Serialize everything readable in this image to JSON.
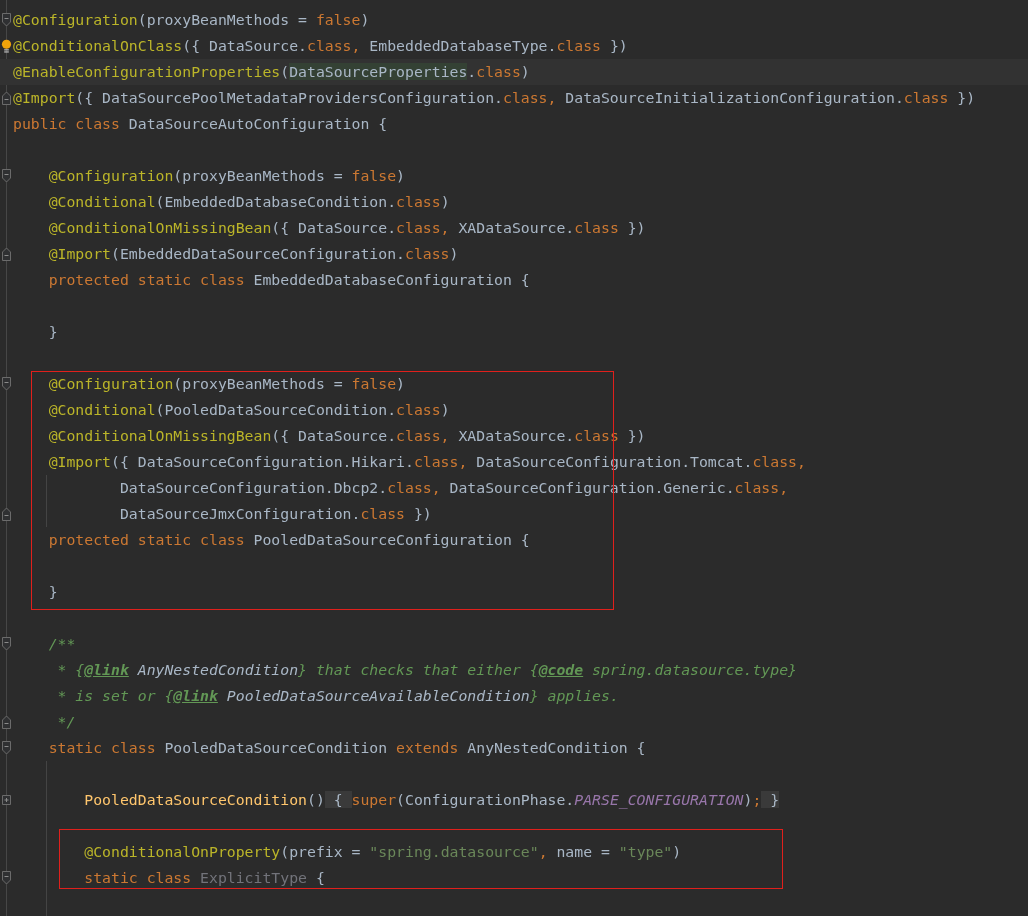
{
  "editor": {
    "sections": [
      {
        "lines": [
          {
            "fold_start": true,
            "tokens": [
              {
                "kind": "annotation",
                "text": "@Configuration"
              },
              {
                "kind": "plain",
                "text": "(proxyBeanMethods = "
              },
              {
                "kind": "keyword",
                "text": "false"
              },
              {
                "kind": "plain",
                "text": ")"
              }
            ]
          },
          {
            "bulb": true,
            "tokens": [
              {
                "kind": "annotation",
                "text": "@ConditionalOnClass"
              },
              {
                "kind": "plain",
                "text": "({ DataSource."
              },
              {
                "kind": "keyword",
                "text": "class, "
              },
              {
                "kind": "plain",
                "text": "EmbeddedDatabaseType."
              },
              {
                "kind": "keyword",
                "text": "class"
              },
              {
                "kind": "plain",
                "text": " })"
              }
            ]
          },
          {
            "current": true,
            "tokens": [
              {
                "kind": "annotation",
                "text": "@EnableConfigurationProperties"
              },
              {
                "kind": "plain",
                "text": "("
              },
              {
                "kind": "match",
                "text": "DataSourceProperties"
              },
              {
                "kind": "plain",
                "text": "."
              },
              {
                "kind": "keyword",
                "text": "class"
              },
              {
                "kind": "plain",
                "text": ")"
              }
            ]
          },
          {
            "fold_end": true,
            "tokens": [
              {
                "kind": "annotation",
                "text": "@Import"
              },
              {
                "kind": "plain",
                "text": "({ DataSourcePoolMetadataProvidersConfiguration."
              },
              {
                "kind": "keyword",
                "text": "class, "
              },
              {
                "kind": "plain",
                "text": "DataSourceInitializationConfiguration."
              },
              {
                "kind": "keyword",
                "text": "class"
              },
              {
                "kind": "plain",
                "text": " })"
              }
            ]
          },
          {
            "tokens": [
              {
                "kind": "keyword",
                "text": "public class "
              },
              {
                "kind": "plain",
                "text": "DataSourceAutoConfiguration {"
              }
            ]
          },
          {
            "kind": "blank"
          },
          {
            "fold_start": true,
            "tokens": [
              {
                "kind": "annotation",
                "text": "    @Configuration"
              },
              {
                "kind": "plain",
                "text": "(proxyBeanMethods = "
              },
              {
                "kind": "keyword",
                "text": "false"
              },
              {
                "kind": "plain",
                "text": ")"
              }
            ]
          },
          {
            "tokens": [
              {
                "kind": "annotation",
                "text": "    @Conditional"
              },
              {
                "kind": "plain",
                "text": "(EmbeddedDatabaseCondition."
              },
              {
                "kind": "keyword",
                "text": "class"
              },
              {
                "kind": "plain",
                "text": ")"
              }
            ]
          },
          {
            "tokens": [
              {
                "kind": "annotation",
                "text": "    @ConditionalOnMissingBean"
              },
              {
                "kind": "plain",
                "text": "({ DataSource."
              },
              {
                "kind": "keyword",
                "text": "class, "
              },
              {
                "kind": "plain",
                "text": "XADataSource."
              },
              {
                "kind": "keyword",
                "text": "class"
              },
              {
                "kind": "plain",
                "text": " })"
              }
            ]
          },
          {
            "fold_end": true,
            "tokens": [
              {
                "kind": "annotation",
                "text": "    @Import"
              },
              {
                "kind": "plain",
                "text": "(EmbeddedDataSourceConfiguration."
              },
              {
                "kind": "keyword",
                "text": "class"
              },
              {
                "kind": "plain",
                "text": ")"
              }
            ]
          },
          {
            "tokens": [
              {
                "kind": "keyword",
                "text": "    protected static class "
              },
              {
                "kind": "plain",
                "text": "EmbeddedDatabaseConfiguration {"
              }
            ]
          },
          {
            "kind": "blank"
          },
          {
            "tokens": [
              {
                "kind": "plain",
                "text": "    }"
              }
            ]
          },
          {
            "kind": "blank"
          }
        ]
      },
      {
        "boxed": true,
        "lines": [
          {
            "fold_start": true,
            "tokens": [
              {
                "kind": "annotation",
                "text": "    @Configuration"
              },
              {
                "kind": "plain",
                "text": "(proxyBeanMethods = "
              },
              {
                "kind": "keyword",
                "text": "false"
              },
              {
                "kind": "plain",
                "text": ")"
              }
            ]
          },
          {
            "tokens": [
              {
                "kind": "annotation",
                "text": "    @Conditional"
              },
              {
                "kind": "plain",
                "text": "(PooledDataSourceCondition."
              },
              {
                "kind": "keyword",
                "text": "class"
              },
              {
                "kind": "plain",
                "text": ")"
              }
            ]
          },
          {
            "tokens": [
              {
                "kind": "annotation",
                "text": "    @ConditionalOnMissingBean"
              },
              {
                "kind": "plain",
                "text": "({ DataSource."
              },
              {
                "kind": "keyword",
                "text": "class, "
              },
              {
                "kind": "plain",
                "text": "XADataSource."
              },
              {
                "kind": "keyword",
                "text": "class"
              },
              {
                "kind": "plain",
                "text": " })"
              }
            ]
          },
          {
            "tokens": [
              {
                "kind": "annotation",
                "text": "    @Import"
              },
              {
                "kind": "plain",
                "text": "({ DataSourceConfiguration.Hikari."
              },
              {
                "kind": "keyword",
                "text": "class, "
              },
              {
                "kind": "plain",
                "text": "DataSourceConfiguration.Tomcat."
              },
              {
                "kind": "keyword",
                "text": "class,"
              }
            ]
          },
          {
            "guide": true,
            "tokens": [
              {
                "kind": "plain",
                "text": "            DataSourceConfiguration.Dbcp2."
              },
              {
                "kind": "keyword",
                "text": "class, "
              },
              {
                "kind": "plain",
                "text": "DataSourceConfiguration.Generic."
              },
              {
                "kind": "keyword",
                "text": "class,"
              }
            ]
          },
          {
            "guide": true,
            "fold_end": true,
            "tokens": [
              {
                "kind": "plain",
                "text": "            DataSourceJmxConfiguration."
              },
              {
                "kind": "keyword",
                "text": "class"
              },
              {
                "kind": "plain",
                "text": " })"
              }
            ]
          },
          {
            "tokens": [
              {
                "kind": "keyword",
                "text": "    protected static class "
              },
              {
                "kind": "plain",
                "text": "PooledDataSourceConfiguration {"
              }
            ]
          },
          {
            "kind": "blank"
          },
          {
            "tokens": [
              {
                "kind": "plain",
                "text": "    }"
              }
            ]
          }
        ]
      },
      {
        "lines": [
          {
            "kind": "blank"
          },
          {
            "fold_start": true,
            "tokens": [
              {
                "kind": "comment",
                "text": "    /**"
              }
            ]
          },
          {
            "tokens": [
              {
                "kind": "comment",
                "text": "     * {"
              },
              {
                "kind": "tag",
                "text": "@link"
              },
              {
                "kind": "reference",
                "text": " AnyNestedCondition"
              },
              {
                "kind": "comment",
                "text": "} that checks that either {"
              },
              {
                "kind": "tag",
                "text": "@code"
              },
              {
                "kind": "comment",
                "text": " spring.datasource.type}"
              }
            ]
          },
          {
            "tokens": [
              {
                "kind": "comment",
                "text": "     * is set or {"
              },
              {
                "kind": "tag",
                "text": "@link"
              },
              {
                "kind": "reference",
                "text": " PooledDataSourceAvailableCondition"
              },
              {
                "kind": "comment",
                "text": "} applies."
              }
            ]
          },
          {
            "fold_end": true,
            "tokens": [
              {
                "kind": "comment",
                "text": "     */"
              }
            ]
          },
          {
            "fold_start": true,
            "tokens": [
              {
                "kind": "keyword",
                "text": "    static class "
              },
              {
                "kind": "plain",
                "text": "PooledDataSourceCondition "
              },
              {
                "kind": "keyword",
                "text": "extends "
              },
              {
                "kind": "plain",
                "text": "AnyNestedCondition {"
              }
            ]
          },
          {
            "kind": "blank",
            "guide": true
          },
          {
            "guide": true,
            "collapsed": true,
            "tokens": [
              {
                "kind": "method",
                "text": "        PooledDataSourceCondition"
              },
              {
                "kind": "plain",
                "text": "()"
              },
              {
                "kind": "folded",
                "text": " { "
              },
              {
                "kind": "keyword",
                "text": "super"
              },
              {
                "kind": "plain",
                "text": "(ConfigurationPhase."
              },
              {
                "kind": "constant",
                "text": "PARSE_CONFIGURATION"
              },
              {
                "kind": "plain",
                "text": ")"
              },
              {
                "kind": "keyword",
                "text": ";"
              },
              {
                "kind": "folded",
                "text": " }"
              }
            ]
          },
          {
            "kind": "blank",
            "guide": true
          }
        ]
      },
      {
        "boxed": true,
        "lines": [
          {
            "guide": true,
            "tokens": [
              {
                "kind": "annotation",
                "text": "        @ConditionalOnProperty"
              },
              {
                "kind": "plain",
                "text": "(prefix = "
              },
              {
                "kind": "string",
                "text": "\"spring.datasource\""
              },
              {
                "kind": "keyword",
                "text": ", "
              },
              {
                "kind": "plain",
                "text": "name = "
              },
              {
                "kind": "string",
                "text": "\"type\""
              },
              {
                "kind": "plain",
                "text": ")"
              }
            ]
          },
          {
            "guide": true,
            "fold_start": true,
            "tokens": [
              {
                "kind": "keyword",
                "text": "        static class "
              },
              {
                "kind": "unused",
                "text": "ExplicitType"
              },
              {
                "kind": "plain",
                "text": " {"
              }
            ]
          }
        ]
      },
      {
        "lines": [
          {
            "kind": "blank",
            "guide": true
          }
        ]
      }
    ]
  }
}
